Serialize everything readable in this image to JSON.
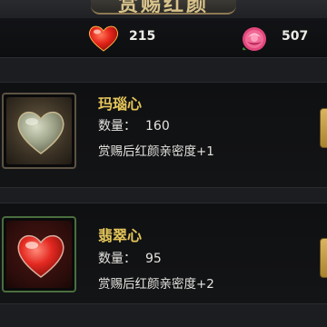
{
  "header": {
    "title": "赏赐红颜"
  },
  "resources": [
    {
      "icon": "red-heart-icon",
      "value": "215"
    },
    {
      "icon": "rose-icon",
      "value": "507"
    }
  ],
  "items": [
    {
      "name": "玛瑙心",
      "qty_label": "数量：",
      "qty": "160",
      "effect": "赏赐后红颜亲密度+1",
      "icon": "agate-heart-icon"
    },
    {
      "name": "翡翠心",
      "qty_label": "数量：",
      "qty": "95",
      "effect": "赏赐后红颜亲密度+2",
      "icon": "jade-heart-icon"
    }
  ],
  "colors": {
    "item_name": "#e6c65a",
    "text": "#e4e3de",
    "gold_button": "#d9b560"
  }
}
